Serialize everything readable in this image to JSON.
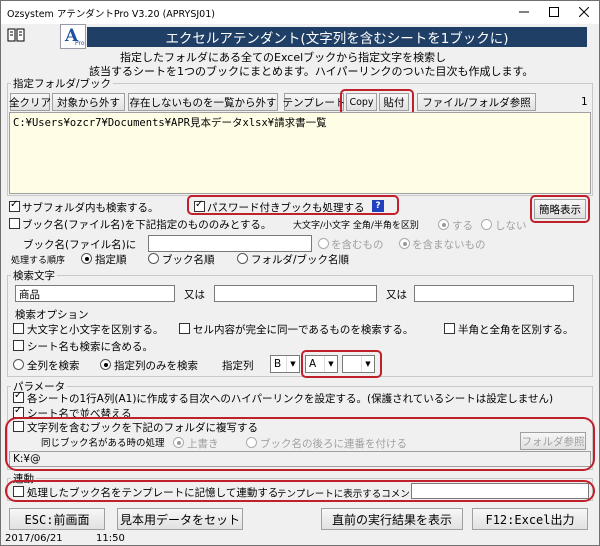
{
  "window": {
    "title": "Ozsystem アテンダントPro V3.20 (APRYSJ01)"
  },
  "header": {
    "title": "エクセルアテンダント(文字列を含むシートを1ブックに)",
    "logo_text": "A",
    "logo_sub": "Pro"
  },
  "intro": {
    "line1": "指定したフォルダにある全てのExcelブックから指定文字を検索し",
    "line2": "該当するシートを1つのブックにまとめます。ハイパーリンクのついた目次も作成します。"
  },
  "folder_section": {
    "label": "指定フォルダ/ブック",
    "buttons": [
      "全クリア",
      "対象から外す",
      "存在しないものを一覧から外す",
      "テンプレート",
      "Copy",
      "貼付",
      "ファイル/フォルダ参照"
    ],
    "count": "1",
    "path": "C:¥Users¥ozcr7¥Documents¥APR見本データxlsx¥請求書一覧"
  },
  "options": {
    "subfolder": "サブフォルダ内も検索する。",
    "password": "パスワード付きブックも処理する",
    "help": "?",
    "simple_view": "簡略表示",
    "bookname_only": "ブック名(ファイル名)を下記指定のもののみとする。",
    "case_label": "大文字/小文字 全角/半角を区別",
    "case_yes": "する",
    "case_no": "しない",
    "bookname_label": "ブック名(ファイル名)に",
    "bookname_value": "",
    "contains": "を含むもの",
    "not_contains": "を含まないもの",
    "order_label": "処理する順序",
    "order_specified": "指定順",
    "order_bookname": "ブック名順",
    "order_folder": "フォルダ/ブック名順"
  },
  "search": {
    "label": "検索文字",
    "term1": "商品",
    "or1": "又は",
    "term2": "",
    "or2": "又は",
    "term3": "",
    "options_label": "検索オプション",
    "case_sensitive": "大文字と小文字を区別する。",
    "exact_match": "セル内容が完全に同一であるものを検索する。",
    "width_sensitive": "半角と全角を区別する。",
    "sheet_name": "シート名も検索に含める。",
    "all_columns": "全列を検索",
    "specified_only": "指定列のみを検索",
    "col_label": "指定列",
    "col1": "B",
    "col2": "A",
    "col3": ""
  },
  "params": {
    "label": "パラメータ",
    "hyperlink": "各シートの1行A列(A1)に作成する目次へのハイパーリンクを設定する。(保護されているシートは設定しません)",
    "sort_by_name": "シート名で並べ替える",
    "copy_books": "文字列を含むブックを下記のフォルダに複写する",
    "same_name_label": "同じブック名がある時の処理",
    "overwrite": "上書き",
    "add_seq": "ブック名の後ろに連番を付ける",
    "folder_ref": "フォルダ参照",
    "copy_path": "K:¥@"
  },
  "link": {
    "label": "連動",
    "remember": "処理したブック名をテンプレートに記憶して連動する",
    "comment_label": "テンプレートに表示するコメント",
    "comment_value": ""
  },
  "footer": {
    "esc": "ESC:前画面",
    "sample": "見本用データをセット",
    "prev_result": "直前の実行結果を表示",
    "f12": "F12:Excel出力"
  },
  "status": {
    "date": "2017/06/21",
    "time": "11:50"
  },
  "colors": {
    "header_bg": "#1f3f66",
    "highlight": "#c0202a",
    "listbox": "#fffde6"
  }
}
